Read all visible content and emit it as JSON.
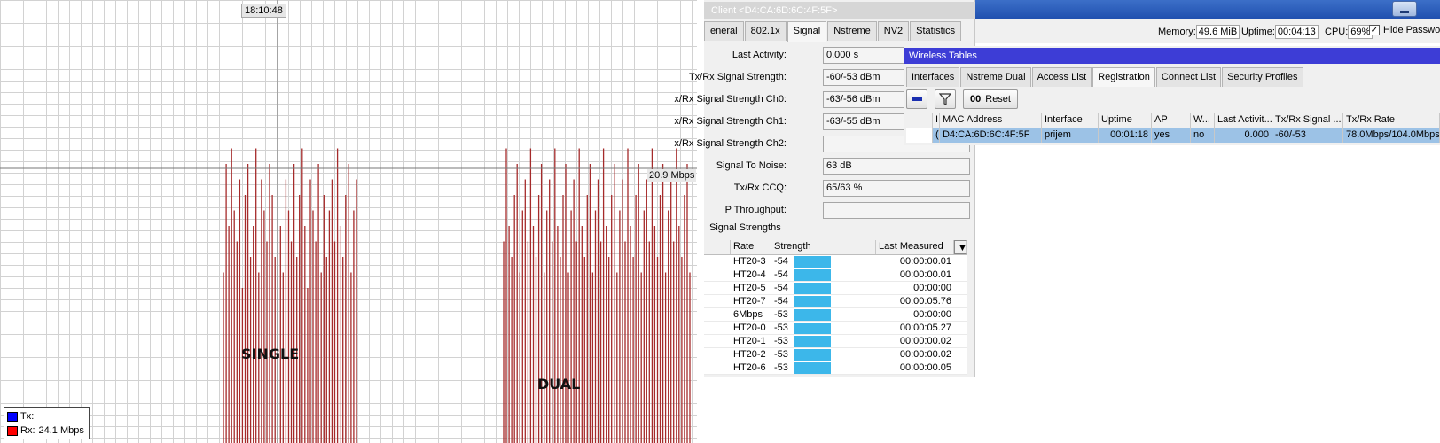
{
  "graph": {
    "time_label": "18:10:48",
    "value_label": "20.9 Mbps",
    "annotation_left": "SINGLE",
    "annotation_right": "DUAL",
    "legend": {
      "tx_label": "Tx:",
      "tx_value": "",
      "rx_label": "Rx:",
      "rx_value": "24.1 Mbps",
      "tx_color": "#0000ff",
      "rx_color": "#ff0000"
    }
  },
  "chart_data": {
    "type": "bar",
    "title": "",
    "xlabel": "",
    "ylabel": "",
    "series": [
      {
        "name": "Rx",
        "color": "#a52a2a",
        "values": [
          11,
          18,
          14,
          19,
          15,
          13,
          17,
          10,
          16,
          18,
          12,
          14,
          19,
          11,
          17,
          15,
          13,
          18,
          16,
          12,
          19,
          14,
          11,
          17,
          15,
          13,
          18,
          12,
          16,
          19,
          14,
          10,
          17,
          15,
          13,
          18,
          11,
          16,
          12,
          15,
          17,
          13,
          19,
          14,
          12,
          16,
          18,
          11,
          15,
          17,
          13,
          19,
          14,
          12,
          16,
          18,
          11,
          15,
          17,
          13,
          19,
          14,
          12,
          16,
          18,
          11,
          15,
          17,
          13,
          19,
          14,
          12,
          16,
          18,
          11,
          15,
          17,
          13,
          19,
          14,
          12,
          16,
          18,
          11,
          15,
          17,
          13,
          19,
          14,
          12,
          16,
          18,
          11,
          15,
          17,
          13,
          19,
          14,
          12,
          16,
          18,
          11,
          15,
          17,
          13,
          19,
          14,
          12,
          16,
          18,
          11,
          15,
          17,
          13,
          19,
          14,
          12,
          16,
          18,
          11,
          15,
          17,
          13,
          19,
          14,
          12,
          16,
          18,
          11,
          15,
          17,
          13,
          19,
          14,
          12,
          16
        ]
      }
    ]
  },
  "client": {
    "title": "Client <D4:CA:6D:6C:4F:5F>",
    "tabs": [
      "eneral",
      "802.1x",
      "Signal",
      "Nstreme",
      "NV2",
      "Statistics"
    ],
    "fields": [
      {
        "label": "Last Activity:",
        "value": "0.000 s"
      },
      {
        "label": "Tx/Rx Signal Strength:",
        "value": "-60/-53 dBm"
      },
      {
        "label": "x/Rx Signal Strength Ch0:",
        "value": "-63/-56 dBm"
      },
      {
        "label": "x/Rx Signal Strength Ch1:",
        "value": "-63/-55 dBm"
      },
      {
        "label": "x/Rx Signal Strength Ch2:",
        "value": ""
      },
      {
        "label": "Signal To Noise:",
        "value": "63 dB"
      },
      {
        "label": "Tx/Rx CCQ:",
        "value": "65/63 %"
      },
      {
        "label": "P Throughput:",
        "value": ""
      }
    ],
    "signal_group": "Signal Strengths",
    "signal_table": {
      "headers": [
        "Rate",
        "Strength",
        "Last Measured"
      ],
      "rows": [
        {
          "rate": "HT20-3",
          "strength": "-54",
          "last": "00:00:00.01"
        },
        {
          "rate": "HT20-4",
          "strength": "-54",
          "last": "00:00:00.01"
        },
        {
          "rate": "HT20-5",
          "strength": "-54",
          "last": "00:00:00"
        },
        {
          "rate": "HT20-7",
          "strength": "-54",
          "last": "00:00:05.76"
        },
        {
          "rate": "6Mbps",
          "strength": "-53",
          "last": "00:00:00"
        },
        {
          "rate": "HT20-0",
          "strength": "-53",
          "last": "00:00:05.27"
        },
        {
          "rate": "HT20-1",
          "strength": "-53",
          "last": "00:00:00.02"
        },
        {
          "rate": "HT20-2",
          "strength": "-53",
          "last": "00:00:00.02"
        },
        {
          "rate": "HT20-6",
          "strength": "-53",
          "last": "00:00:00.05"
        }
      ],
      "bar_color": "#3cb7ea"
    }
  },
  "status": {
    "memory_label": "Memory:",
    "memory_value": "49.6 MiB",
    "uptime_label": "Uptime:",
    "uptime_value": "00:04:13",
    "cpu_label": "CPU:",
    "cpu_value": "69%",
    "hide_passwords": "Hide Passwords"
  },
  "wireless": {
    "title": "Wireless Tables",
    "tabs": [
      "Interfaces",
      "Nstreme Dual",
      "Access List",
      "Registration",
      "Connect List",
      "Security Profiles"
    ],
    "reset_label": "Reset",
    "reset_prefix": "00",
    "table": {
      "headers": [
        "",
        "I",
        "MAC Address",
        "Interface",
        "Uptime",
        "AP",
        "W...",
        "Last Activit...",
        "Tx/Rx Signal ...",
        "Tx/Rx Rate"
      ],
      "row": [
        "",
        "(",
        "D4:CA:6D:6C:4F:5F",
        "prijem",
        "00:01:18",
        "yes",
        "no",
        "0.000",
        "-60/-53",
        "78.0Mbps/104.0Mbps"
      ]
    }
  }
}
